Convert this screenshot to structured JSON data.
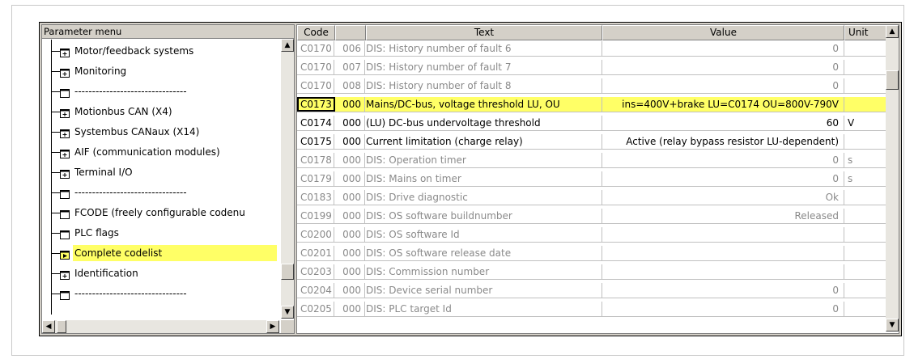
{
  "tree": {
    "header": "Parameter menu",
    "items": [
      {
        "label": "Motor/feedback systems",
        "icon": "expand-folder-icon"
      },
      {
        "label": "Monitoring",
        "icon": "expand-folder-icon"
      },
      {
        "label": "--------------------------------",
        "icon": "folder-icon"
      },
      {
        "label": "Motionbus CAN (X4)",
        "icon": "expand-folder-icon"
      },
      {
        "label": "Systembus CANaux (X14)",
        "icon": "expand-folder-icon"
      },
      {
        "label": "AIF (communication modules)",
        "icon": "expand-folder-icon"
      },
      {
        "label": "Terminal I/O",
        "icon": "expand-folder-icon"
      },
      {
        "label": "--------------------------------",
        "icon": "folder-icon"
      },
      {
        "label": "FCODE (freely configurable codenu",
        "icon": "folder-icon"
      },
      {
        "label": "PLC flags",
        "icon": "folder-icon"
      },
      {
        "label": "Complete codelist",
        "icon": "play-folder-icon",
        "selected": true
      },
      {
        "label": "Identification",
        "icon": "expand-folder-icon"
      },
      {
        "label": "--------------------------------",
        "icon": "folder-icon"
      }
    ]
  },
  "grid": {
    "headers": {
      "code": "Code",
      "text": "Text",
      "value": "Value",
      "unit": "Unit"
    },
    "rows": [
      {
        "code": "C0170",
        "sub": "006",
        "text": "DIS: History number of fault 6",
        "value": "0",
        "unit": "",
        "style": "grey"
      },
      {
        "code": "C0170",
        "sub": "007",
        "text": "DIS: History number of fault 7",
        "value": "0",
        "unit": "",
        "style": "grey"
      },
      {
        "code": "C0170",
        "sub": "008",
        "text": "DIS: History number of fault 8",
        "value": "0",
        "unit": "",
        "style": "grey"
      },
      {
        "code": "C0173",
        "sub": "000",
        "text": "Mains/DC-bus, voltage threshold LU, OU",
        "value": "ins=400V+brake  LU=C0174  OU=800V-790V",
        "unit": "",
        "style": "hl"
      },
      {
        "code": "C0174",
        "sub": "000",
        "text": "(LU)  DC-bus undervoltage threshold",
        "value": "60",
        "unit": "V",
        "style": "normal"
      },
      {
        "code": "C0175",
        "sub": "000",
        "text": "Current limitation (charge relay)",
        "value": "Active  (relay bypass resistor LU-dependent)",
        "unit": "",
        "style": "normal"
      },
      {
        "code": "C0178",
        "sub": "000",
        "text": "DIS: Operation timer",
        "value": "0",
        "unit": "s",
        "style": "grey"
      },
      {
        "code": "C0179",
        "sub": "000",
        "text": "DIS: Mains on timer",
        "value": "0",
        "unit": "s",
        "style": "grey"
      },
      {
        "code": "C0183",
        "sub": "000",
        "text": "DIS: Drive diagnostic",
        "value": "Ok",
        "unit": "",
        "style": "grey"
      },
      {
        "code": "C0199",
        "sub": "000",
        "text": "DIS: OS software buildnumber",
        "value": "Released",
        "unit": "",
        "style": "grey"
      },
      {
        "code": "C0200",
        "sub": "000",
        "text": "DIS: OS software Id",
        "value": "",
        "unit": "",
        "style": "grey"
      },
      {
        "code": "C0201",
        "sub": "000",
        "text": "DIS: OS software release date",
        "value": "",
        "unit": "",
        "style": "grey"
      },
      {
        "code": "C0203",
        "sub": "000",
        "text": "DIS: Commission number",
        "value": "",
        "unit": "",
        "style": "grey"
      },
      {
        "code": "C0204",
        "sub": "000",
        "text": "DIS: Device serial number",
        "value": "0",
        "unit": "",
        "style": "grey"
      },
      {
        "code": "C0205",
        "sub": "000",
        "text": "DIS: PLC target Id",
        "value": "0",
        "unit": "",
        "style": "grey"
      }
    ]
  },
  "colors": {
    "highlight": "#ffff66",
    "grey_text": "#8a8a8a"
  }
}
